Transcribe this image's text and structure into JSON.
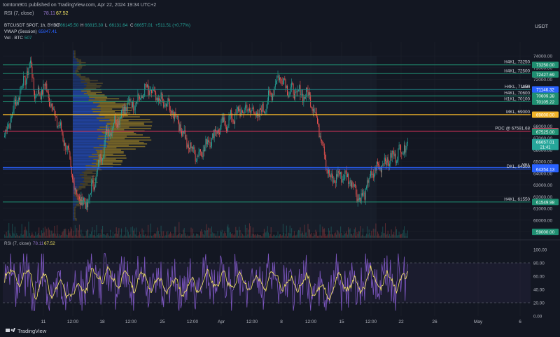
{
  "header": {
    "publish_line": "tomtom901 published on TradingView.com, Apr 22, 2024 19:34 UTC+2",
    "top_rsi_label": "RSI (7, close)",
    "top_rsi_v1": "78.11",
    "top_rsi_v2": "67.52",
    "currency": "USDT"
  },
  "legend": {
    "symbol": "BTCUSDT SPOT, 1h, BYBIT",
    "o_label": "O",
    "o_value": "66145.50",
    "h_label": "H",
    "h_value": "66815.30",
    "l_label": "L",
    "l_value": "66131.64",
    "c_label": "C",
    "c_value": "66657.01",
    "change": "+511.51 (+0.77%)",
    "vwap_label": "VWAP (Session)",
    "vwap_value": "65847.41",
    "vol_label": "Vol · BTC",
    "vol_value": "507"
  },
  "footer": {
    "brand": "TradingView"
  },
  "colors": {
    "bg": "#131722",
    "grid": "#1e222d",
    "up": "#26a69a",
    "down": "#ef5350",
    "rsi": "#7e57c2",
    "rsi_ma": "#f5e664",
    "level_teal": "#1f8f72",
    "level_blue": "#2962ff",
    "level_gold": "#f0b429",
    "level_pink": "#f0365f"
  },
  "chart_data": [
    {
      "type": "candlestick",
      "title": "BTCUSDT SPOT, 1h, BYBIT",
      "ylim": [
        58500,
        75200
      ],
      "y_ticks": [
        59000,
        60000,
        61000,
        62000,
        63000,
        64000,
        65000,
        66000,
        67000,
        68000,
        69000,
        70000,
        71000,
        72000,
        73000,
        74000
      ],
      "x_ticks": [
        "11",
        "12:00",
        "18",
        "12:00",
        "25",
        "12:00",
        "Apr",
        "12:00",
        "8",
        "12:00",
        "15",
        "12:00",
        "22",
        "26",
        "May",
        "6"
      ],
      "ohlc_anchor_series": [
        {
          "day": 0,
          "close": 67200
        },
        {
          "day": 1,
          "close": 69800
        },
        {
          "day": 2,
          "close": 72100
        },
        {
          "day": 2.6,
          "close": 73300
        },
        {
          "day": 3,
          "close": 70500
        },
        {
          "day": 4,
          "close": 71400
        },
        {
          "day": 5,
          "close": 68800
        },
        {
          "day": 6,
          "close": 66500
        },
        {
          "day": 7,
          "close": 62300
        },
        {
          "day": 8,
          "close": 61200
        },
        {
          "day": 9,
          "close": 63800
        },
        {
          "day": 10,
          "close": 67300
        },
        {
          "day": 11,
          "close": 68500
        },
        {
          "day": 12,
          "close": 69800
        },
        {
          "day": 13,
          "close": 70200
        },
        {
          "day": 14,
          "close": 71200
        },
        {
          "day": 15,
          "close": 70300
        },
        {
          "day": 16,
          "close": 69800
        },
        {
          "day": 17,
          "close": 68600
        },
        {
          "day": 18,
          "close": 66400
        },
        {
          "day": 19,
          "close": 65500
        },
        {
          "day": 20,
          "close": 66700
        },
        {
          "day": 21,
          "close": 67800
        },
        {
          "day": 22,
          "close": 68500
        },
        {
          "day": 23,
          "close": 69200
        },
        {
          "day": 24,
          "close": 69500
        },
        {
          "day": 25,
          "close": 68900
        },
        {
          "day": 26,
          "close": 70400
        },
        {
          "day": 27,
          "close": 72400
        },
        {
          "day": 28,
          "close": 71000
        },
        {
          "day": 29,
          "close": 70800
        },
        {
          "day": 30,
          "close": 70600
        },
        {
          "day": 31,
          "close": 67500
        },
        {
          "day": 32,
          "close": 63300
        },
        {
          "day": 33,
          "close": 63900
        },
        {
          "day": 34,
          "close": 63500
        },
        {
          "day": 35,
          "close": 61600
        },
        {
          "day": 36,
          "close": 63800
        },
        {
          "day": 37,
          "close": 64800
        },
        {
          "day": 38,
          "close": 65300
        },
        {
          "day": 39,
          "close": 66000
        },
        {
          "day": 39.6,
          "close": 66657
        }
      ],
      "levels": [
        {
          "value": 73250,
          "label": "H4KL, 73250",
          "tag": "73250.00",
          "color": "#1f8f72"
        },
        {
          "value": 72427.69,
          "tag": "72427.69",
          "color": "#1f8f72"
        },
        {
          "value": 72500,
          "label": "H4KL, 72500",
          "tag": "",
          "color": "#1f8f72"
        },
        {
          "value": 71148.56,
          "label": "VAH",
          "tag": "71148.56",
          "color": "#2962ff"
        },
        {
          "value": 71146.32,
          "tag": "71146.32",
          "color": "#2962ff"
        },
        {
          "value": 71150,
          "label": "H4KL, 71150",
          "tag": "",
          "color": "#1f8f72"
        },
        {
          "value": 70609.38,
          "tag": "70609.38",
          "color": "#1f8f72"
        },
        {
          "value": 70600,
          "label": "H4KL, 70600",
          "tag": "",
          "color": "#1f8f72"
        },
        {
          "value": 70105.22,
          "tag": "70105.22",
          "color": "#1f8f72"
        },
        {
          "value": 70100,
          "label": "H1KL, 70100",
          "tag": "",
          "color": "#1f8f72"
        },
        {
          "value": 69000,
          "label": "MKL, 69000",
          "tag": "69000.00",
          "color": "#f0b429"
        },
        {
          "value": 67591.68,
          "tag": "67591.68",
          "color": "#f0365f"
        },
        {
          "value": 67525,
          "tag": "67525.00",
          "color": "#1f8f72"
        },
        {
          "value": 67591.68,
          "label": "POC @ 67591.68",
          "tag": "",
          "color": "#f0365f"
        },
        {
          "value": 64500,
          "label": "VAL",
          "tag": "64500.00",
          "color": "#2962ff"
        },
        {
          "value": 64354.13,
          "label": "DKL, 64500",
          "tag": "64354.13",
          "color": "#2962ff"
        },
        {
          "value": 61549.98,
          "label": "H4KL, 61550",
          "tag": "61549.98",
          "color": "#1f8f72"
        },
        {
          "value": 59000,
          "tag": "59000.00",
          "color": "#1f8f72"
        }
      ],
      "last_price_tag": "66657.01",
      "last_price_sub": "21:41"
    },
    {
      "type": "line",
      "title": "RSI (7, close)",
      "legend_v1": "78.11",
      "legend_v2": "67.52",
      "ylim": [
        0,
        100
      ],
      "y_ticks": [
        0,
        20,
        40,
        60,
        80,
        100
      ],
      "y_tick_labels": [
        "0.00",
        "20.00",
        "40.00",
        "60.00",
        "80.00",
        "100.00"
      ],
      "bands": [
        20,
        80
      ],
      "last_rsi": 78.11,
      "last_rsi_ma": 67.52
    }
  ]
}
